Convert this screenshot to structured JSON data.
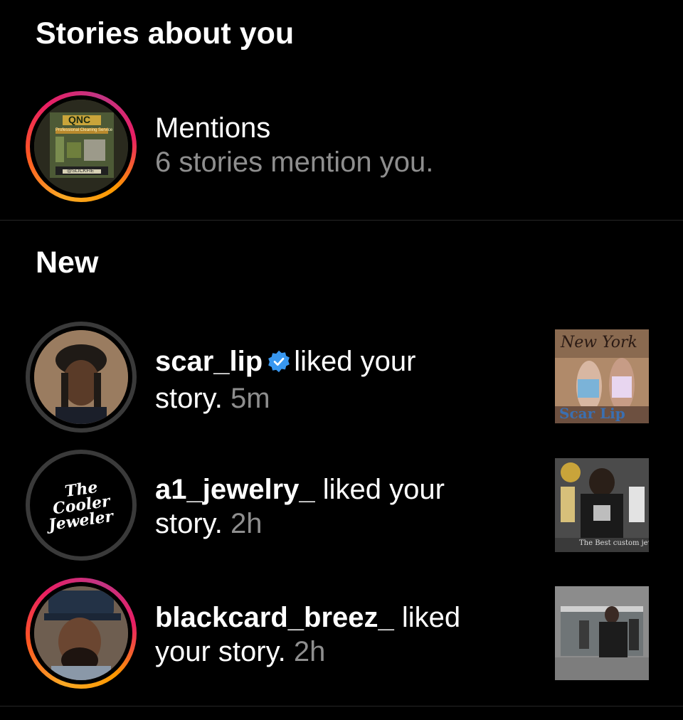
{
  "sections": {
    "stories_title": "Stories about you",
    "new_title": "New"
  },
  "mentions": {
    "title": "Mentions",
    "subtitle": "6 stories mention you.",
    "avatar_text": {
      "brand": "QNC",
      "line": "Professional Cleaning Service",
      "handle": "@SLICKFIE"
    }
  },
  "notifications": [
    {
      "username": "scar_lip",
      "verified": true,
      "action": "liked your",
      "action_cont": "story.",
      "time": "5m",
      "thumb_text": {
        "top": "New York",
        "bottom": "Scar Lip"
      }
    },
    {
      "username": "a1_jewelry_",
      "verified": false,
      "action": "liked your",
      "action_cont": "story.",
      "time": "2h",
      "avatar_text": [
        "The",
        "Cooler",
        "Jeweler"
      ],
      "thumb_text": {
        "bottom": "The Best custom jewelry"
      }
    },
    {
      "username": "blackcard_breez_",
      "verified": false,
      "action": "liked",
      "action_cont": "your story.",
      "time": "2h"
    }
  ],
  "colors": {
    "background": "#000000",
    "muted": "#8e8e8e",
    "verified": "#3897f0",
    "divider": "#262626"
  }
}
